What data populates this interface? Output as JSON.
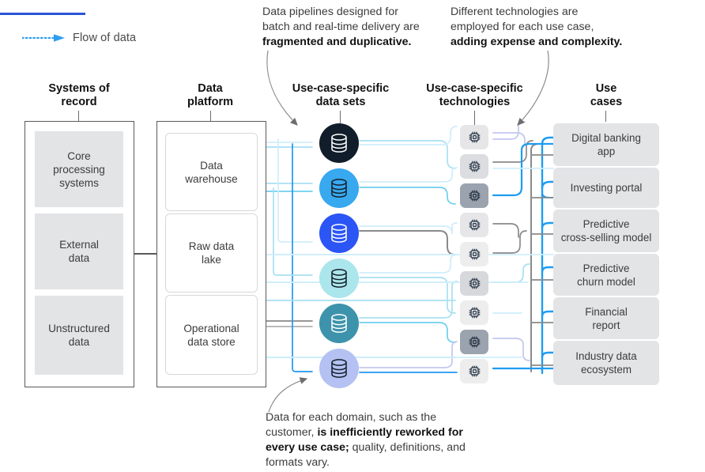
{
  "legend": {
    "rule_color": "#2b55d4",
    "arrow_color": "#2f9ef0",
    "label": "Flow of data",
    "icon": "dotted-arrow-icon"
  },
  "callouts": [
    {
      "id": "pipelines",
      "plain_1": "Data pipelines designed for",
      "plain_2": "batch and real-time delivery are",
      "bold": "fragmented and duplicative."
    },
    {
      "id": "technologies",
      "plain_1": "Different technologies are",
      "plain_2": "employed for each use case,",
      "bold": "adding expense and complexity."
    },
    {
      "id": "domain",
      "plain_1": "Data for each domain, such as the",
      "plain_2": "customer, ",
      "bold_1": "is inefficiently reworked for",
      "bold_2": "every use case;",
      "plain_3": " quality, definitions, and",
      "plain_4": "formats vary."
    }
  ],
  "columns": {
    "systems_of_record": {
      "header_line1": "Systems of",
      "header_line2": "record",
      "items": [
        {
          "label": "Core\nprocessing\nsystems",
          "lines": [
            "Core",
            "processing",
            "systems"
          ]
        },
        {
          "label": "External data",
          "lines": [
            "External",
            "data"
          ]
        },
        {
          "label": "Unstructured data",
          "lines": [
            "Unstructured",
            "data"
          ]
        }
      ]
    },
    "data_platform": {
      "header_line1": "Data",
      "header_line2": "platform",
      "items": [
        {
          "lines": [
            "Data",
            "warehouse"
          ]
        },
        {
          "lines": [
            "Raw data",
            "lake"
          ]
        },
        {
          "lines": [
            "Operational",
            "data store"
          ]
        }
      ]
    },
    "use_case_data_sets": {
      "header_line1": "Use-case-specific",
      "header_line2": "data sets",
      "icon": "database-icon",
      "nodes": [
        {
          "index": 1,
          "color": "#111d2b",
          "glyph_color": "#ffffff"
        },
        {
          "index": 2,
          "color": "#38a8ef",
          "glyph_color": "#15202b"
        },
        {
          "index": 3,
          "color": "#2b55f5",
          "glyph_color": "#ffffff"
        },
        {
          "index": 4,
          "color": "#abe6ec",
          "glyph_color": "#15202b"
        },
        {
          "index": 5,
          "color": "#3d93ab",
          "glyph_color": "#ffffff"
        },
        {
          "index": 6,
          "color": "#b4c1f2",
          "glyph_color": "#15202b"
        }
      ]
    },
    "use_case_technologies": {
      "header_line1": "Use-case-specific",
      "header_line2": "technologies",
      "icon": "cpu-chip-icon",
      "nodes": [
        {
          "index": 1,
          "bg": "#e6e6e8"
        },
        {
          "index": 2,
          "bg": "#dcdde0"
        },
        {
          "index": 3,
          "bg": "#9ba3ae"
        },
        {
          "index": 4,
          "bg": "#e6e6e8"
        },
        {
          "index": 5,
          "bg": "#ededee"
        },
        {
          "index": 6,
          "bg": "#d6d8dc"
        },
        {
          "index": 7,
          "bg": "#ededee"
        },
        {
          "index": 8,
          "bg": "#9ba3ae"
        },
        {
          "index": 9,
          "bg": "#ededee"
        }
      ]
    },
    "use_cases": {
      "header_line1": "Use",
      "header_line2": "cases",
      "items": [
        {
          "lines": [
            "Digital banking",
            "app"
          ]
        },
        {
          "lines": [
            "Investing portal"
          ]
        },
        {
          "lines": [
            "Predictive",
            "cross-selling model"
          ]
        },
        {
          "lines": [
            "Predictive",
            "churn model"
          ]
        },
        {
          "lines": [
            "Financial",
            "report"
          ]
        },
        {
          "lines": [
            "Industry data",
            "ecosystem"
          ]
        }
      ]
    }
  },
  "wire_colors": {
    "pale_cyan": "#cfeefb",
    "light_cyan": "#a8e0f2",
    "cyan": "#6fd0ee",
    "blue": "#2196f3",
    "bright_blue": "#1e9cf0",
    "grey": "#8a8a8a",
    "dark_grey": "#707070",
    "lavender": "#c3c7ee"
  }
}
